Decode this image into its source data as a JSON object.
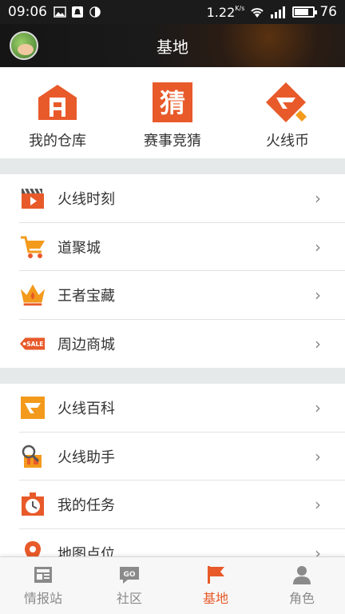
{
  "status": {
    "time": "09:06",
    "speed": "1.22",
    "speed_unit": "K/s",
    "battery": "76",
    "battery_level": 0.76
  },
  "header": {
    "title": "基地"
  },
  "quick": [
    {
      "label": "我的仓库",
      "icon": "warehouse-icon"
    },
    {
      "label": "赛事竞猜",
      "icon": "guess-icon"
    },
    {
      "label": "火线币",
      "icon": "cf-coin-icon"
    }
  ],
  "section1": [
    {
      "label": "火线时刻",
      "icon": "video-clapper-icon"
    },
    {
      "label": "道聚城",
      "icon": "shopping-cart-icon"
    },
    {
      "label": "王者宝藏",
      "icon": "crown-icon"
    },
    {
      "label": "周边商城",
      "icon": "sale-tag-icon"
    }
  ],
  "section2": [
    {
      "label": "火线百科",
      "icon": "cf-encyclopedia-icon"
    },
    {
      "label": "火线助手",
      "icon": "assistant-magnifier-icon"
    },
    {
      "label": "我的任务",
      "icon": "task-clock-icon"
    },
    {
      "label": "地图点位",
      "icon": "map-pin-icon"
    }
  ],
  "tabs": [
    {
      "label": "情报站",
      "icon": "news-icon",
      "active": false
    },
    {
      "label": "社区",
      "icon": "community-icon",
      "active": false
    },
    {
      "label": "基地",
      "icon": "flag-icon",
      "active": true
    },
    {
      "label": "角色",
      "icon": "user-icon",
      "active": false
    }
  ],
  "colors": {
    "accent": "#e85a2a",
    "orange": "#f39a1c"
  }
}
